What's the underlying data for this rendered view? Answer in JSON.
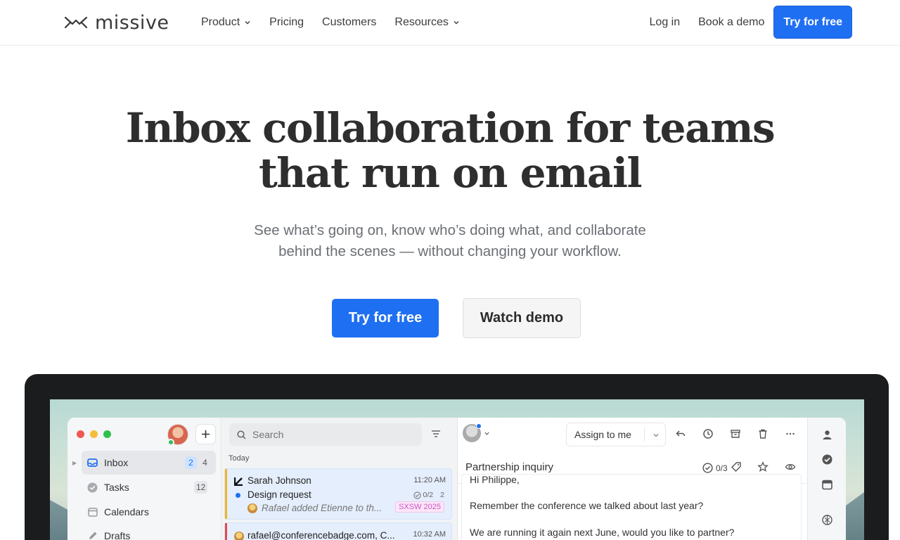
{
  "nav": {
    "logo_text": "missive",
    "links": [
      {
        "label": "Product",
        "has_menu": true
      },
      {
        "label": "Pricing",
        "has_menu": false
      },
      {
        "label": "Customers",
        "has_menu": false
      },
      {
        "label": "Resources",
        "has_menu": true
      }
    ],
    "login": "Log in",
    "book_demo": "Book a demo",
    "cta": "Try for free"
  },
  "hero": {
    "title_line1": "Inbox collaboration for teams",
    "title_line2": "that run on email",
    "subtitle_line1": "See what’s going on, know who’s doing what, and collaborate",
    "subtitle_line2": "behind the scenes — without changing your workflow.",
    "primary_cta": "Try for free",
    "secondary_cta": "Watch demo"
  },
  "colors": {
    "accent": "#1f6ff2",
    "traffic_red": "#ee5a52",
    "traffic_yellow": "#f5bd3c",
    "traffic_green": "#2fbf4a",
    "tag_pink": "#d054c8"
  },
  "app": {
    "sidebar": {
      "items": [
        {
          "label": "Inbox",
          "icon": "inbox-icon",
          "badges": [
            "2",
            "4"
          ],
          "active": true
        },
        {
          "label": "Tasks",
          "icon": "check-circle-icon",
          "badges": [
            "12"
          ],
          "active": false
        },
        {
          "label": "Calendars",
          "icon": "calendar-icon",
          "badges": [],
          "active": false
        },
        {
          "label": "Drafts",
          "icon": "pencil-icon",
          "badges": [],
          "active": false
        }
      ]
    },
    "list": {
      "search_placeholder": "Search",
      "group": "Today",
      "messages": [
        {
          "from": "Sarah Johnson",
          "time": "11:20 AM",
          "subject": "Design request",
          "tasks": "0/2",
          "count": "2",
          "preview": "Rafael added Etienne to th...",
          "tag": "SXSW 2025"
        },
        {
          "from": "rafael@conferencebadge.com, C...",
          "time": "10:32 AM"
        }
      ]
    },
    "pane": {
      "assign": "Assign to me",
      "subject": "Partnership inquiry",
      "task_count": "0/3",
      "body": [
        "Hi Philippe,",
        "Remember the conference we talked about last year?",
        "We are running it again next June, would you like to partner?"
      ]
    }
  }
}
